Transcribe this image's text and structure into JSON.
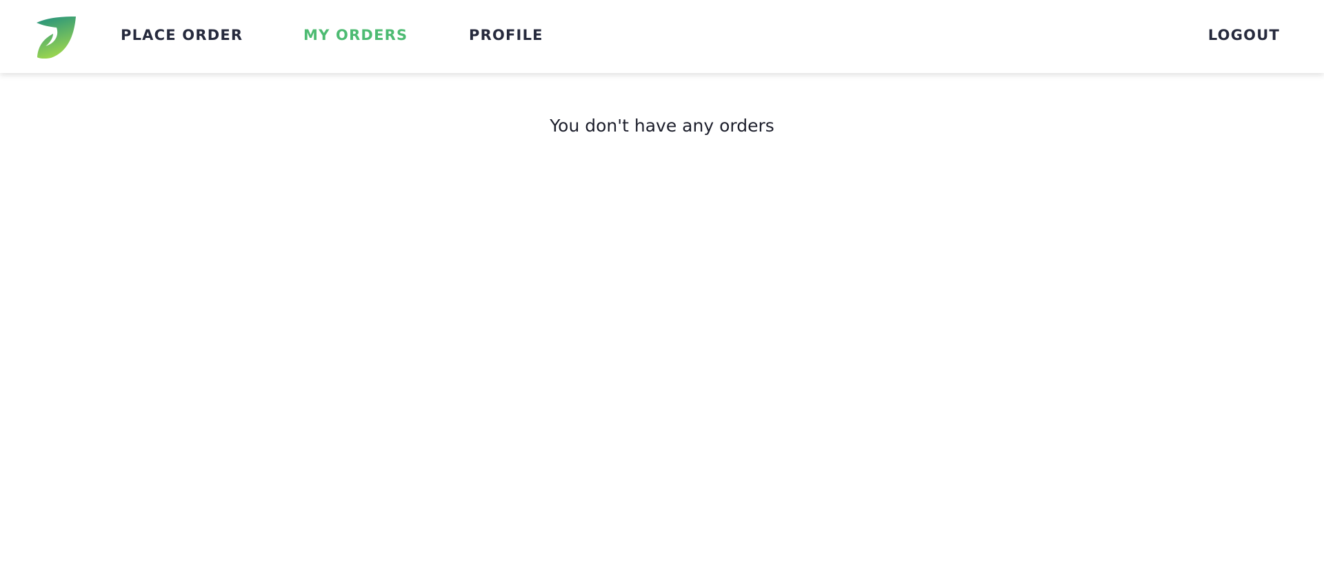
{
  "nav": {
    "logo": "leaf-logo-icon",
    "items": [
      {
        "label": "PLACE ORDER",
        "active": false
      },
      {
        "label": "MY ORDERS",
        "active": true
      },
      {
        "label": "PROFILE",
        "active": false
      }
    ],
    "logout_label": "LOGOUT"
  },
  "main": {
    "empty_message": "You don't have any orders"
  },
  "colors": {
    "accent": "#4dbb72",
    "nav_text": "#262a3d",
    "logo_top": "#1f8f7f",
    "logo_bottom": "#9bd54f"
  }
}
